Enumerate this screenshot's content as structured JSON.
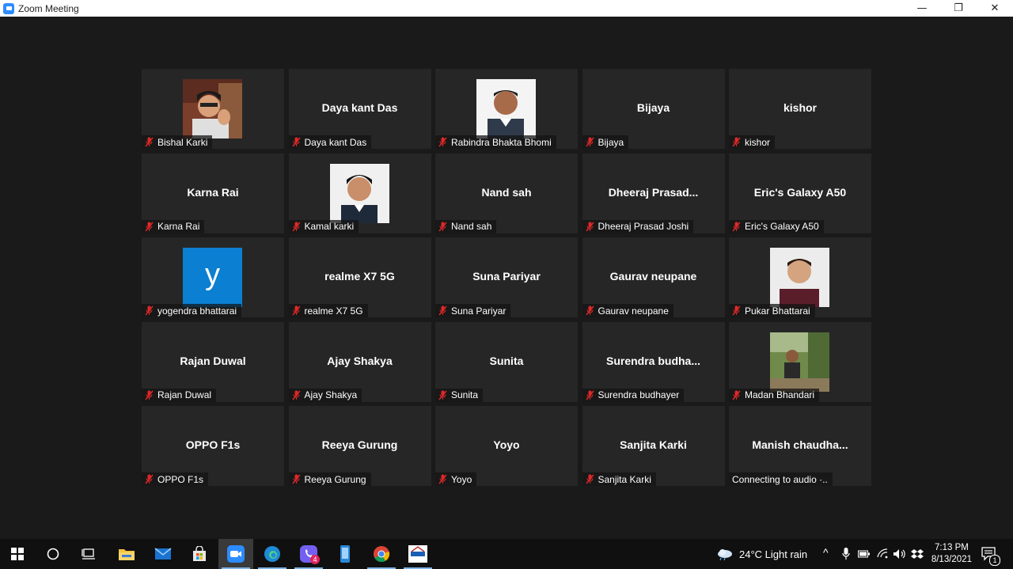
{
  "window": {
    "title": "Zoom Meeting",
    "minimize": "—",
    "restore": "❐",
    "close": "✕"
  },
  "participants": [
    {
      "display": "",
      "label": "Bishal Karki",
      "photo": "boy-thinking"
    },
    {
      "display": "Daya kant Das",
      "label": "Daya kant Das"
    },
    {
      "display": "",
      "label": "Rabindra Bhakta Bhomi",
      "photo": "man-id"
    },
    {
      "display": "Bijaya",
      "label": "Bijaya"
    },
    {
      "display": "kishor",
      "label": "kishor"
    },
    {
      "display": "Karna Rai",
      "label": "Karna Rai"
    },
    {
      "display": "",
      "label": "Kamal karki",
      "photo": "young-man-id"
    },
    {
      "display": "Nand sah",
      "label": "Nand sah"
    },
    {
      "display": "Dheeraj  Prasad...",
      "label": "Dheeraj Prasad Joshi"
    },
    {
      "display": "Eric's Galaxy A50",
      "label": "Eric's Galaxy A50"
    },
    {
      "display": "",
      "label": "yogendra bhattarai",
      "photo": "letter-y",
      "avatar_letter": "y"
    },
    {
      "display": "realme X7 5G",
      "label": "realme X7 5G"
    },
    {
      "display": "Suna Pariyar",
      "label": "Suna Pariyar"
    },
    {
      "display": "Gaurav neupane",
      "label": "Gaurav neupane"
    },
    {
      "display": "",
      "label": "Pukar Bhattarai",
      "photo": "man-portrait"
    },
    {
      "display": "Rajan Duwal",
      "label": "Rajan Duwal"
    },
    {
      "display": "Ajay Shakya",
      "label": "Ajay Shakya"
    },
    {
      "display": "Sunita",
      "label": "Sunita"
    },
    {
      "display": "Surendra  budha...",
      "label": "Surendra budhayer"
    },
    {
      "display": "",
      "label": "Madan Bhandari",
      "photo": "outdoor"
    },
    {
      "display": "OPPO F1s",
      "label": "OPPO F1s"
    },
    {
      "display": "Reeya Gurung",
      "label": "Reeya Gurung"
    },
    {
      "display": "Yoyo",
      "label": "Yoyo"
    },
    {
      "display": "Sanjita Karki",
      "label": "Sanjita Karki"
    },
    {
      "display": "Manish  chaudha...",
      "label": "Connecting to audio ·..",
      "no_mic": true
    }
  ],
  "taskbar": {
    "apps": [
      "windows-start",
      "search",
      "task-view",
      "file-explorer",
      "mail",
      "store",
      "zoom",
      "edge",
      "viber",
      "phone-app",
      "chrome",
      "hcc-app"
    ],
    "viber_badge": "4",
    "weather": "24°C  Light rain",
    "time": "7:13 PM",
    "date": "8/13/2021",
    "notifications": "1"
  },
  "colors": {
    "background": "#1a1a1a",
    "tile": "#262626",
    "muted_mic": "#e02828",
    "zoom_blue": "#2d8cff"
  }
}
